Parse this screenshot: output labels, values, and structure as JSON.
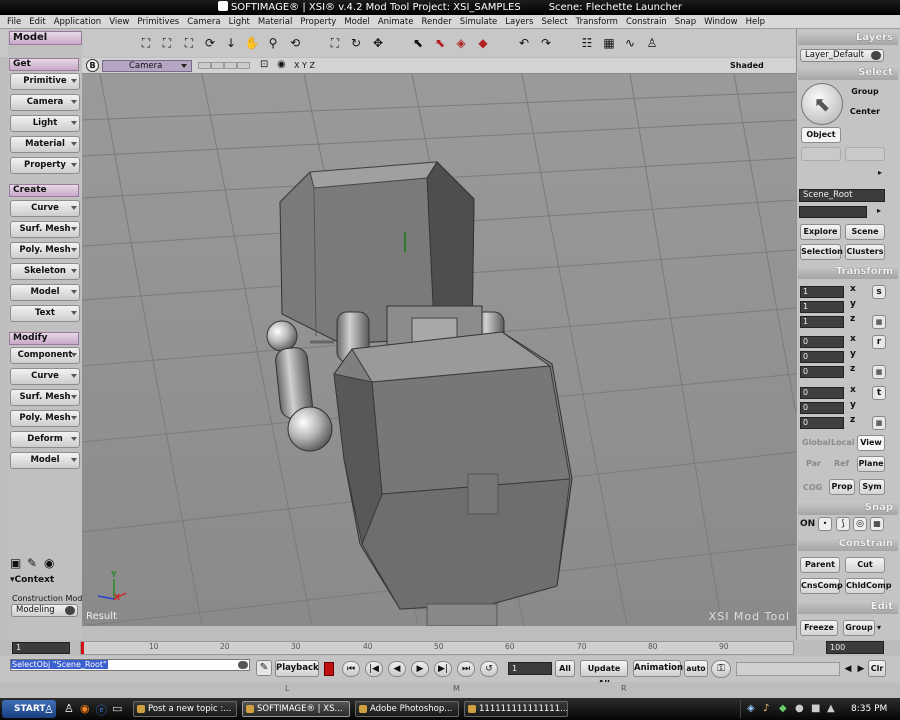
{
  "window": {
    "title": "SOFTIMAGE® | XSI® v.4.2 Mod Tool Project: XSI_SAMPLES",
    "scene": "Scene: Flechette Launcher"
  },
  "menu": [
    "File",
    "Edit",
    "Application",
    "View",
    "Primitives",
    "Camera",
    "Light",
    "Material",
    "Property",
    "Model",
    "Animate",
    "Render",
    "Simulate",
    "Layers",
    "Select",
    "Transform",
    "Constrain",
    "Snap",
    "Window",
    "Help"
  ],
  "left_panel": {
    "title": "Model",
    "get": {
      "header": "Get",
      "items": [
        "Primitive",
        "Camera",
        "Light",
        "Material",
        "Property"
      ]
    },
    "create": {
      "header": "Create",
      "items": [
        "Curve",
        "Surf. Mesh",
        "Poly. Mesh",
        "Skeleton",
        "Model",
        "Text"
      ]
    },
    "modify": {
      "header": "Modify",
      "items": [
        "Component",
        "Curve",
        "Surf. Mesh",
        "Poly. Mesh",
        "Deform",
        "Model"
      ]
    },
    "context_label": "▾Context",
    "construction_mode_label": "Construction Mode",
    "construction_mode_value": "Modeling"
  },
  "viewport": {
    "label": "B",
    "camera": "Camera",
    "axes": "X Y Z",
    "shading": "Shaded",
    "result_label": "Result",
    "watermark": "XSI Mod Tool",
    "axis_x": "X",
    "axis_y": "Y"
  },
  "right_panel": {
    "layers_header": "Layers",
    "layer_value": "Layer_Default",
    "select_header": "Select",
    "group_button": "Group",
    "center_button": "Center",
    "object_button": "Object",
    "selection_field": "Scene_Root",
    "explore_button": "Explore",
    "scene_button": "Scene",
    "selection_button": "Selection",
    "clusters_button": "Clusters",
    "transform_header": "Transform",
    "scale": [
      "1",
      "1",
      "1"
    ],
    "rotate": [
      "0",
      "0",
      "0"
    ],
    "translate": [
      "0",
      "0",
      "0"
    ],
    "axis_labels": [
      "x",
      "y",
      "z"
    ],
    "scale_icon": "s",
    "rotate_icon": "r",
    "translate_icon": "t",
    "global": "Global",
    "local": "Local",
    "view": "View",
    "par": "Par",
    "ref": "Ref",
    "plane": "Plane",
    "cog": "COG",
    "prop": "Prop",
    "sym": "Sym",
    "snap_header": "Snap",
    "snap_on": "ON",
    "constrain_header": "Constrain",
    "parent_button": "Parent",
    "cut_button": "Cut",
    "cnscomp_button": "CnsComp",
    "chldcomp_button": "ChldComp",
    "edit_header": "Edit",
    "freeze_button": "Freeze",
    "edit_group_button": "Group"
  },
  "timeline": {
    "start": "1",
    "end": "100",
    "ticks": [
      "10",
      "20",
      "30",
      "40",
      "50",
      "60",
      "70",
      "80",
      "90"
    ]
  },
  "command_bar": {
    "command": "SelectObj \"Scene_Root\"",
    "playback": "Playback",
    "frame": "1",
    "all": "All",
    "update_all": "Update All",
    "animation": "Animation",
    "auto": "auto",
    "clr": "Clr"
  },
  "status_bar": {
    "l": "L",
    "m": "M",
    "r": "R"
  },
  "taskbar": {
    "start": "START",
    "tasks": [
      "Post a new topic :...",
      "SOFTIMAGE® | XS...",
      "Adobe Photoshop...",
      "111111111111111..."
    ],
    "clock": "8:35 PM"
  }
}
